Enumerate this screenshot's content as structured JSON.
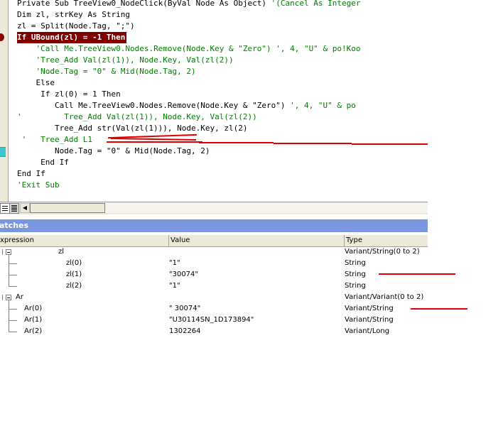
{
  "editor": {
    "lines": [
      [
        {
          "t": "Private Sub TreeView0_NodeClick(ByVal Node As Object) "
        },
        {
          "t": "'(Cancel As Integer",
          "c": "cm"
        }
      ],
      [
        {
          "t": "Dim zl, strKey As String"
        }
      ],
      [
        {
          "t": "zl = Split(Node.Tag, \";\")"
        }
      ],
      [
        {
          "t": "If UBound(zl) = -1 Then",
          "c": "hl"
        }
      ],
      [
        {
          "t": "    "
        },
        {
          "t": "'Call Me.TreeView0.Nodes.Remove(Node.Key & \"Zero\") ', 4, \"U\" & po!Koo",
          "c": "cm"
        }
      ],
      [
        {
          "t": "    "
        },
        {
          "t": "'Tree_Add Val(zl(1)), Node.Key, Val(zl(2))",
          "c": "cm"
        }
      ],
      [
        {
          "t": "    "
        },
        {
          "t": "'Node.Tag = \"0\" & Mid(Node.Tag, 2)",
          "c": "cm"
        }
      ],
      [
        {
          "t": "    Else"
        }
      ],
      [
        {
          "t": "     If zl(0) = 1 Then"
        }
      ],
      [
        {
          "t": "        Call Me.TreeView0.Nodes.Remove(Node.Key & \"Zero\") "
        },
        {
          "t": "', 4, \"U\" & po",
          "c": "cm"
        }
      ],
      [
        {
          "t": "'         Tree_Add Val(zl(1)), Node.Key, Val(zl(2))",
          "c": "cm"
        }
      ],
      [
        {
          "t": "        Tree_Add str(Val(zl(1))), Node.Key, zl(2)"
        }
      ],
      [
        {
          "t": " '   Tree_Add L1",
          "c": "cm"
        }
      ],
      [
        {
          "t": "        Node.Tag = \"0\" & Mid(Node.Tag, 2)"
        }
      ],
      [
        {
          "t": "     End If"
        }
      ],
      [
        {
          "t": "End If"
        }
      ],
      [
        {
          "t": "'Exit Sub",
          "c": "cm"
        }
      ]
    ]
  },
  "watches": {
    "title": "atches",
    "columns": [
      "xpression",
      "Value",
      "Type"
    ],
    "rows": [
      {
        "expr": "zl",
        "value": "",
        "type": "Variant/String(0 to 2)"
      },
      {
        "expr": "zl(0)",
        "value": "\"1\"",
        "type": "String"
      },
      {
        "expr": "zl(1)",
        "value": "\"30074\"",
        "type": "String"
      },
      {
        "expr": "zl(2)",
        "value": "\"1\"",
        "type": "String"
      },
      {
        "expr": "Ar",
        "value": "",
        "type": "Variant/Variant(0 to 2)"
      },
      {
        "expr": "Ar(0)",
        "value": "\" 30074\"",
        "type": "Variant/String"
      },
      {
        "expr": "Ar(1)",
        "value": "\"U30114SN_1D173894\"",
        "type": "Variant/String"
      },
      {
        "expr": "Ar(2)",
        "value": "1302264",
        "type": "Variant/Long"
      }
    ]
  },
  "colors": {
    "highlight_bg": "#800000",
    "comment": "#008000",
    "titlebar": "#7a96df",
    "annotation_red": "#e00000"
  }
}
